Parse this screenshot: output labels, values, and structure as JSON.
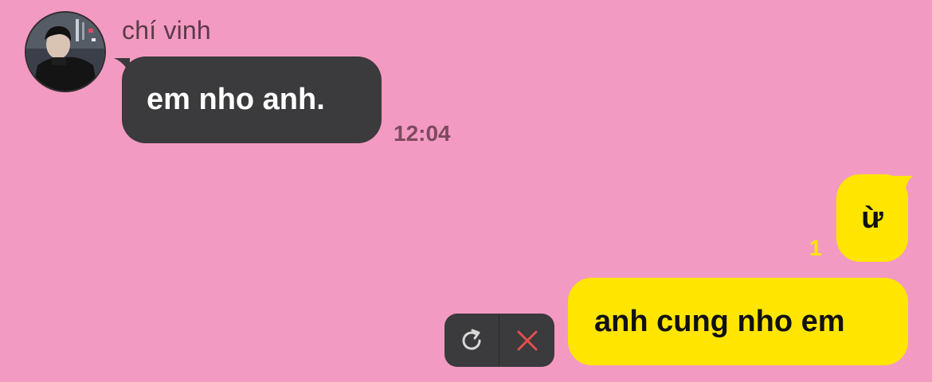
{
  "conversation": {
    "contact_name": "chí vinh",
    "messages": [
      {
        "direction": "incoming",
        "text": "em nho anh.",
        "time": "12:04"
      },
      {
        "direction": "outgoing",
        "text": "ừ",
        "unread_count": "1"
      },
      {
        "direction": "outgoing",
        "text": "anh cung nho em",
        "status": "failed"
      }
    ]
  },
  "actions": {
    "retry_icon": "refresh-icon",
    "cancel_icon": "close-icon"
  },
  "colors": {
    "background": "#f39ac2",
    "incoming_bubble": "#3b3a3c",
    "outgoing_bubble": "#ffe500",
    "cancel_accent": "#e0514f"
  }
}
